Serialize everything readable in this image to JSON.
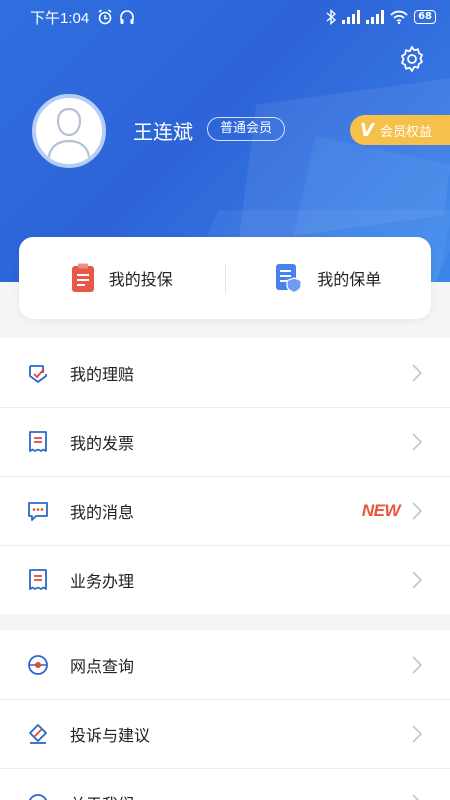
{
  "status_bar": {
    "time": "下午1:04",
    "battery": "68"
  },
  "profile": {
    "name": "王连斌",
    "member_level": "普通会员",
    "benefit_badge": "会员权益",
    "benefit_mark": "V"
  },
  "quick_actions": [
    {
      "label": "我的投保",
      "icon": "clipboard-icon"
    },
    {
      "label": "我的保单",
      "icon": "policy-shield-icon"
    }
  ],
  "menu_group1": [
    {
      "label": "我的理赔",
      "icon": "claim-icon"
    },
    {
      "label": "我的发票",
      "icon": "invoice-icon"
    },
    {
      "label": "我的消息",
      "icon": "message-icon",
      "badge": "NEW"
    },
    {
      "label": "业务办理",
      "icon": "business-icon"
    }
  ],
  "menu_group2": [
    {
      "label": "网点查询",
      "icon": "location-icon"
    },
    {
      "label": "投诉与建议",
      "icon": "feedback-icon"
    },
    {
      "label": "关于我们",
      "icon": "about-icon"
    }
  ],
  "colors": {
    "primary": "#2f6fe0",
    "icon_blue": "#2a67c9",
    "icon_red": "#e0483c",
    "badge_gold": "#f6c14a",
    "new_red": "#e8563a"
  }
}
